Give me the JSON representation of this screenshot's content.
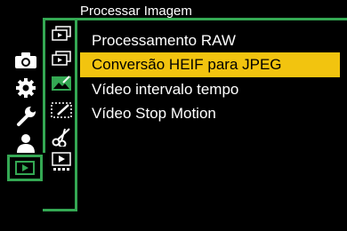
{
  "header": {
    "title": "Processar Imagem"
  },
  "menu": {
    "items": [
      {
        "label": "Processamento RAW",
        "selected": false
      },
      {
        "label": "Conversão HEIF para JPEG",
        "selected": true
      },
      {
        "label": "Vídeo intervalo tempo",
        "selected": false
      },
      {
        "label": "Vídeo Stop Motion",
        "selected": false
      }
    ]
  },
  "left_tabs": [
    "camera-icon",
    "gear-icon",
    "wrench-icon",
    "person-icon",
    "playback-icon"
  ],
  "sub_tabs": [
    "playback-list-icon-1",
    "playback-list-icon-2",
    "image-edit-icon",
    "image-edit-dashed-icon",
    "scissors-icon",
    "video-frames-icon"
  ],
  "colors": {
    "accent_green": "#34a853",
    "highlight_yellow": "#f2c40f",
    "background": "#000000",
    "text": "#ffffff"
  }
}
